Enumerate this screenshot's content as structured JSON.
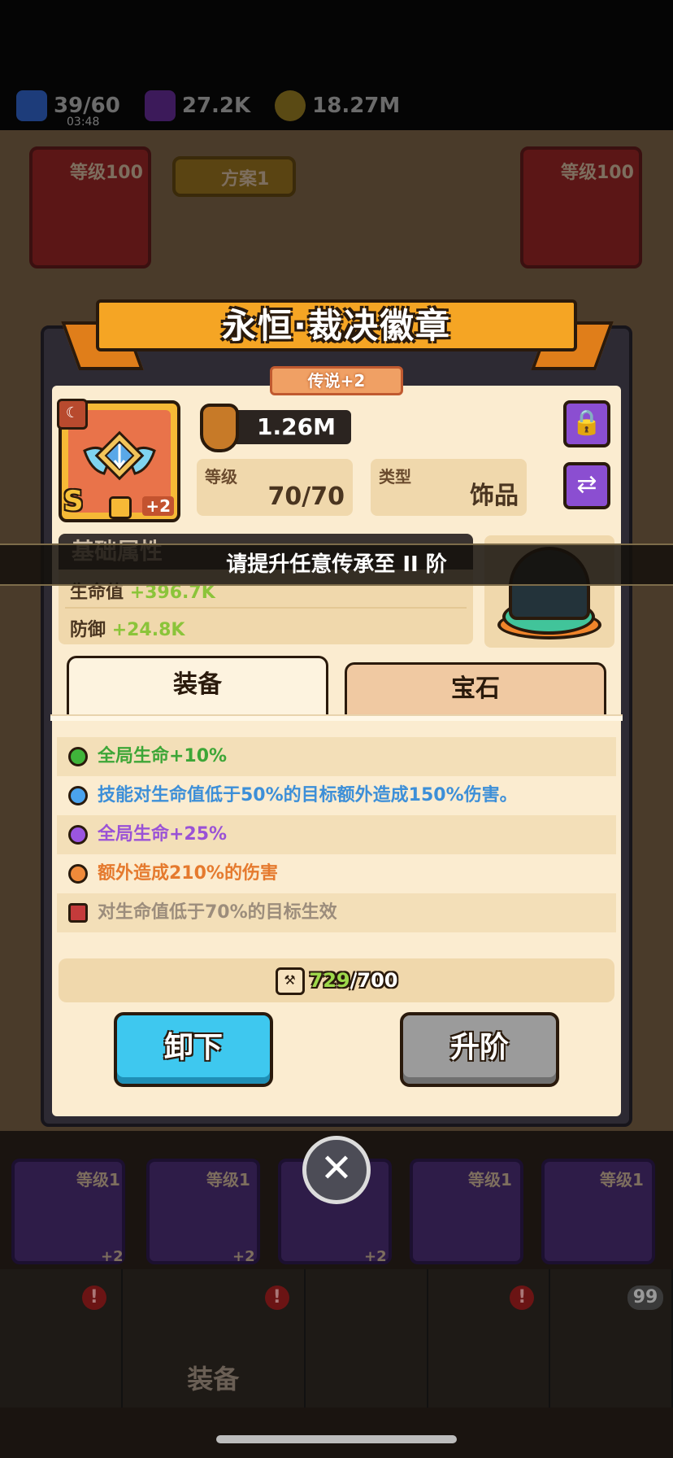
{
  "resources": {
    "energy": "39/60",
    "energy_timer": "03:48",
    "gems": "27.2K",
    "coins": "18.27M"
  },
  "background": {
    "left_card_level": "等级100",
    "right_card_level": "等级100",
    "plan_button": "方案1",
    "bottom_cards_level": [
      "等级1",
      "等级1",
      "等级1",
      "等级1"
    ],
    "bottom_plus": [
      "+2",
      "+2",
      "+2"
    ],
    "nav_active_label": "装备",
    "nav_badge_count": "99"
  },
  "modal": {
    "title": "永恒·裁决徽章",
    "rarity": "传说+2",
    "item": {
      "grade": "S",
      "plus": "+2",
      "icon": "winged-badge-icon"
    },
    "power": "1.26M",
    "level_label": "等级",
    "level_value": "70/70",
    "type_label": "类型",
    "type_value": "饰品",
    "lock_button": "lock-icon",
    "swap_button": "swap-icon",
    "base_attr": {
      "title": "基础属性",
      "hp_label": "生命值",
      "hp_value": "+396.7K",
      "def_label": "防御",
      "def_value": "+24.8K"
    },
    "toast": "请提升任意传承至 II 阶",
    "tabs": [
      {
        "label": "装备",
        "active": true
      },
      {
        "label": "宝石",
        "active": false
      }
    ],
    "effects": [
      {
        "text": "全局生命+10%",
        "color": "#3da637",
        "dot": "#3fb43a"
      },
      {
        "text": "技能对生命值低于50%的目标额外造成150%伤害。",
        "color": "#3d8fd8",
        "dot": "#4aa3ee"
      },
      {
        "text": "全局生命+25%",
        "color": "#9a52d6",
        "dot": "#9b55e0"
      },
      {
        "text": "额外造成210%的伤害",
        "color": "#e57a2e",
        "dot": "#f08a3a"
      },
      {
        "text": "对生命值低于70%的目标生效",
        "color": "#9c8d7c",
        "locked": true
      }
    ],
    "material": {
      "have": "729",
      "sep": "/",
      "need": "700"
    },
    "buttons": {
      "unequip": "卸下",
      "upgrade": "升阶"
    }
  }
}
